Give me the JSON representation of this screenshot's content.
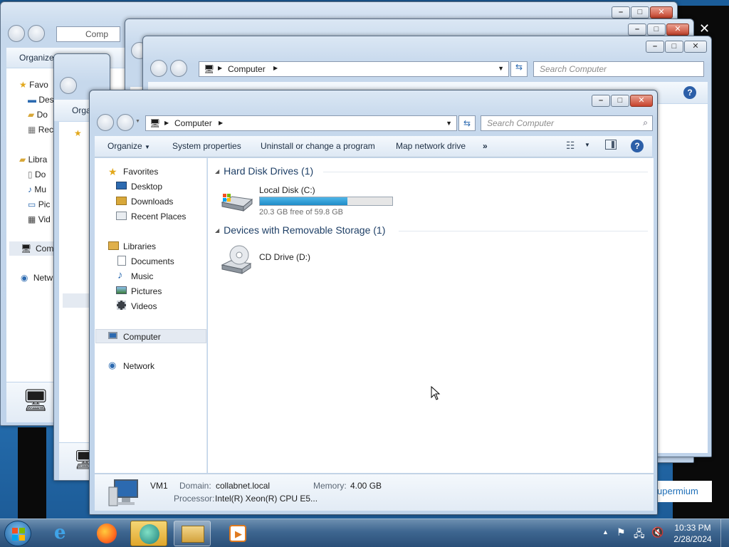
{
  "main_window": {
    "address_path": "Computer",
    "search_placeholder": "Search Computer",
    "toolbar": {
      "organize": "Organize",
      "system_properties": "System properties",
      "uninstall": "Uninstall or change a program",
      "map_network": "Map network drive",
      "more": "»"
    },
    "nav": {
      "favorites": "Favorites",
      "desktop": "Desktop",
      "downloads": "Downloads",
      "recent_places": "Recent Places",
      "libraries": "Libraries",
      "documents": "Documents",
      "music": "Music",
      "pictures": "Pictures",
      "videos": "Videos",
      "computer": "Computer",
      "network": "Network"
    },
    "groups": {
      "hard_disk": "Hard Disk Drives (1)",
      "removable": "Devices with Removable Storage (1)"
    },
    "drives": {
      "c_name": "Local Disk (C:)",
      "c_free": "20.3 GB free of 59.8 GB",
      "c_used_fraction": 0.66,
      "d_name": "CD Drive (D:)"
    },
    "details": {
      "name": "VM1",
      "domain_label": "Domain:",
      "domain": "collabnet.local",
      "memory_label": "Memory:",
      "memory": "4.00 GB",
      "processor_label": "Processor:",
      "processor": "Intel(R) Xeon(R) CPU E5..."
    }
  },
  "background_windows": {
    "address_path": "Computer",
    "search_placeholder": "Search Computer",
    "organize": "Organize",
    "partial_address": "Comp",
    "partial_favorites": "Favo",
    "partial_desktop": "Des",
    "partial_downloads": "Do",
    "partial_recent": "Rec",
    "partial_libraries": "Libra",
    "partial_documents": "Do",
    "partial_music": "Mu",
    "partial_pictures": "Pic",
    "partial_videos": "Vid",
    "partial_computer": "Com",
    "partial_network": "Netw",
    "partial_organize2": "Orga"
  },
  "notification_partial": "upermium",
  "taskbar": {
    "time": "10:33 PM",
    "date": "2/28/2024"
  },
  "colors": {
    "accent": "#26a0da",
    "selection": "#e4eaf2"
  }
}
